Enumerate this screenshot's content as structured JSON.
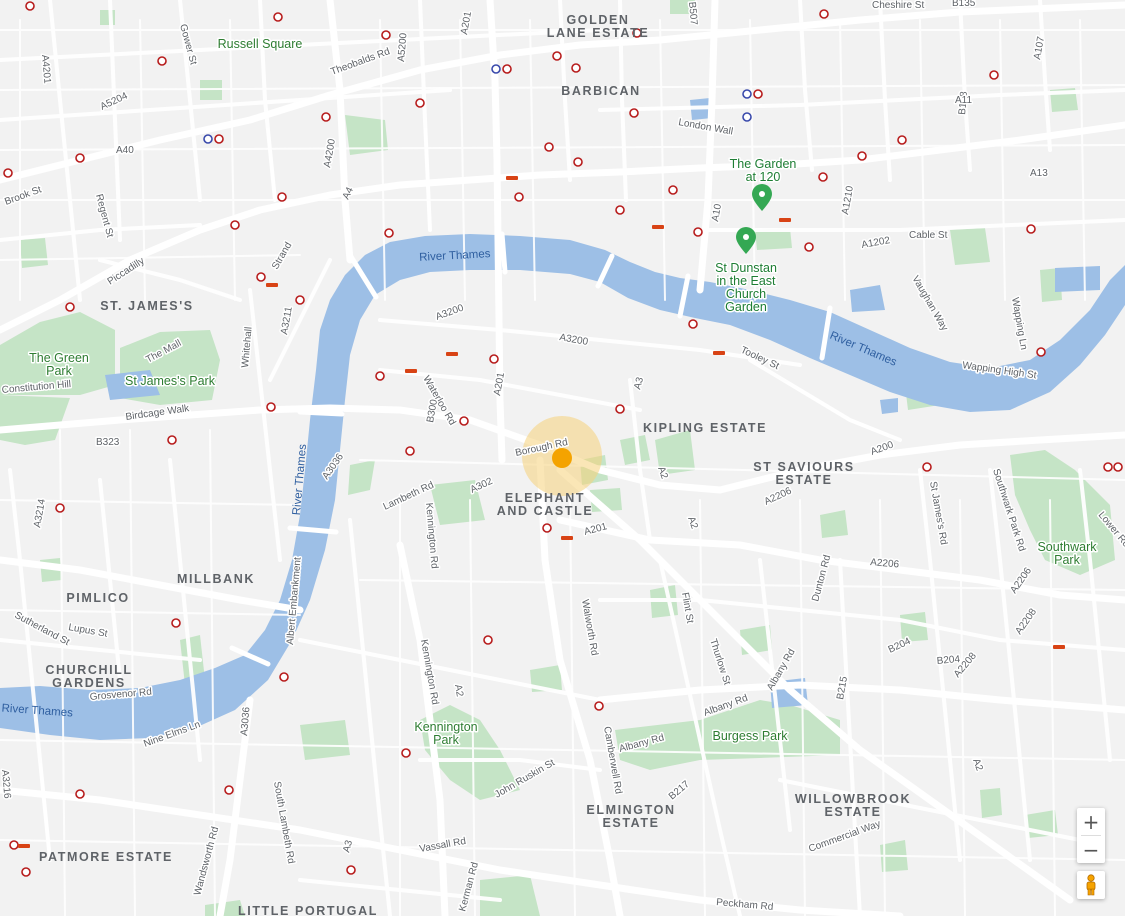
{
  "map": {
    "areas": [
      "GOLDEN",
      "LANE ESTATE",
      "BARBICAN",
      "ST. JAMES'S",
      "KIPLING ESTATE",
      "ST SAVIOURS",
      "ESTATE",
      "ELEPHANT",
      "AND CASTLE",
      "MILLBANK",
      "PIMLICO",
      "CHURCHILL",
      "GARDENS",
      "ELMINGTON",
      "ESTATE",
      "WILLOWBROOK",
      "ESTATE",
      "PATMORE ESTATE",
      "LITTLE PORTUGAL"
    ],
    "parks": [
      "Russell Square",
      "The Green",
      "Park",
      "St James's Park",
      "Kennington",
      "Park",
      "Burgess Park",
      "Southwark",
      "Park"
    ],
    "pois": [
      "The Garden",
      "at 120",
      "St Dunstan",
      "in the East",
      "Church",
      "Garden"
    ],
    "rivers": [
      "River Thames",
      "River Thames",
      "River Thames",
      "River Thames"
    ],
    "roads": [
      "Gower St",
      "A4201",
      "A5204",
      "A40",
      "Brook St",
      "Regent St",
      "Piccadilly",
      "Theobalds Rd",
      "A5200",
      "A201",
      "A4200",
      "A4",
      "Strand",
      "A3211",
      "Whitehall",
      "The Mall",
      "Constitution Hill",
      "Birdcage Walk",
      "B323",
      "A3214",
      "A3036",
      "A3200",
      "Waterloo Rd",
      "B300",
      "A201",
      "A3200",
      "A3",
      "London Wall",
      "A10",
      "A1210",
      "A13",
      "Cable St",
      "A1202",
      "Tooley St",
      "Vaughan Way",
      "Wapping Ln",
      "Wapping High St",
      "Borough Rd",
      "Lambeth Rd",
      "A302",
      "Kennington Rd",
      "A2",
      "A201",
      "A2206",
      "A200",
      "St James's Rd",
      "Southwark Park Rd",
      "Lower Rd",
      "A2206",
      "Dunton Rd",
      "Flint St",
      "Thurlow St",
      "Walworth Rd",
      "Albany Rd",
      "Albany Rd",
      "Albany Rd",
      "B215",
      "B204",
      "A2208",
      "A2206",
      "Kennington Rd",
      "A3036",
      "John Ruskin St",
      "Camberwell Rd",
      "B217",
      "Commercial Way",
      "Vassall Rd",
      "Albert Embankment",
      "Sutherland St",
      "Lupus St",
      "Grosvenor Rd",
      "Nine Elms Ln",
      "South Lambeth Rd",
      "Wandsworth Rd",
      "A3",
      "A3216",
      "Peckham Rd",
      "Kerman Rd",
      "B507",
      "A107",
      "Cheshire St",
      "B135",
      "B108",
      "A11",
      "B204",
      "A2208",
      "A2",
      "A2",
      "A2"
    ]
  },
  "selection": {
    "marker_color": "#f4a300",
    "halo_color": "#f6d27a"
  },
  "controls": {
    "zoom_in": "+",
    "zoom_out": "−",
    "pegman_icon": "pegman-icon"
  },
  "colors": {
    "land": "#f2f2f2",
    "water": "#9dbfe6",
    "park": "#c5e4c6",
    "road": "#ffffff",
    "area_text": "#5f6368",
    "park_text": "#2e7d32"
  }
}
